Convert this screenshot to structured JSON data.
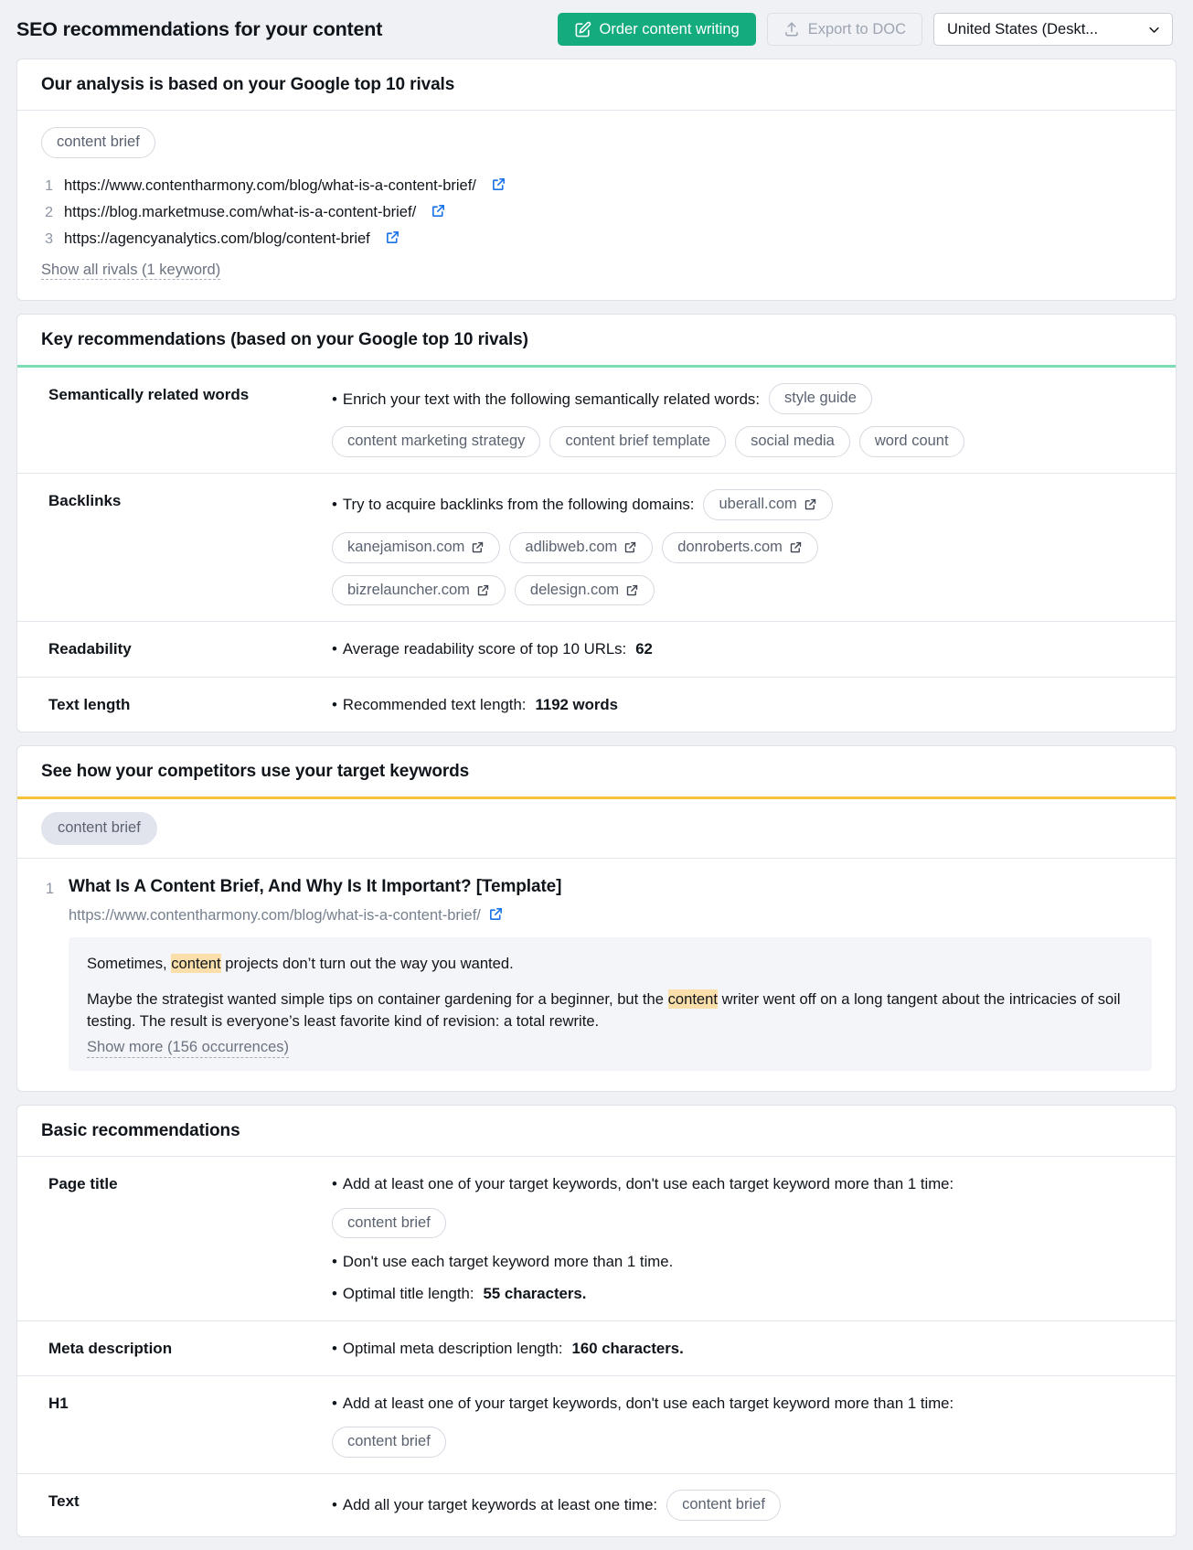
{
  "header": {
    "title": "SEO recommendations for your content",
    "order_button": "Order content writing",
    "export_button": "Export to DOC",
    "locale_select": "United States (Deskt...",
    "accent_green": "#14ab7f",
    "icons": {
      "order": "edit-square-icon",
      "export": "upload-icon",
      "chevron": "chevron-down-icon"
    }
  },
  "rivals_card": {
    "title": "Our analysis is based on your Google top 10 rivals",
    "keyword_chip": "content brief",
    "rivals": [
      {
        "index": "1",
        "url": "https://www.contentharmony.com/blog/what-is-a-content-brief/"
      },
      {
        "index": "2",
        "url": "https://blog.marketmuse.com/what-is-a-content-brief/"
      },
      {
        "index": "3",
        "url": "https://agencyanalytics.com/blog/content-brief"
      }
    ],
    "show_all_link": "Show all rivals (1 keyword)"
  },
  "key_recommendations": {
    "title": "Key recommendations (based on your Google top 10 rivals)",
    "accent_color": "#7ddcb4",
    "rows": [
      {
        "label": "Semantically related words",
        "bullet": "Enrich your text with the following semantically related words:",
        "chips": [
          "style guide",
          "content marketing strategy",
          "content brief template",
          "social media",
          "word count"
        ]
      },
      {
        "label": "Backlinks",
        "bullet": "Try to acquire backlinks from the following domains:",
        "chips": [
          "uberall.com",
          "kanejamison.com",
          "adlibweb.com",
          "donroberts.com",
          "bizrelauncher.com",
          "delesign.com"
        ]
      },
      {
        "label": "Readability",
        "bullet": "Average readability score of top 10 URLs:",
        "value": "62"
      },
      {
        "label": "Text length",
        "bullet": "Recommended text length:",
        "value": "1192 words"
      }
    ]
  },
  "competitors_card": {
    "title": "See how your competitors use your target keywords",
    "accent_color": "#f5c33b",
    "keyword_chip": "content brief",
    "result": {
      "index": "1",
      "title": "What Is A Content Brief, And Why Is It Important? [Template]",
      "url": "https://www.contentharmony.com/blog/what-is-a-content-brief/",
      "snippet_p1_before": "Sometimes, ",
      "snippet_p1_highlight": "content",
      "snippet_p1_after": " projects don’t turn out the way you wanted.",
      "snippet_p2_before": "Maybe the strategist wanted simple tips on container gardening for a beginner, but the ",
      "snippet_p2_highlight": "content",
      "snippet_p2_after": " writer went off on a long tangent about the intricacies of soil testing. The result is everyone’s least favorite kind of revision: a total rewrite.",
      "show_more_link": "Show more (156 occurrences)",
      "highlight_color": "#fadfab"
    }
  },
  "basic_recommendations": {
    "title": "Basic recommendations",
    "rows": [
      {
        "label": "Page title",
        "bullet1": "Add at least one of your target keywords, don't use each target keyword more than 1 time:",
        "chips": [
          "content brief"
        ],
        "bullet2": "Don't use each target keyword more than 1 time.",
        "bullet3_text": "Optimal title length:",
        "bullet3_value": "55 characters."
      },
      {
        "label": "Meta description",
        "bullet1_text": "Optimal meta description length:",
        "bullet1_value": "160 characters."
      },
      {
        "label": "H1",
        "bullet1": "Add at least one of your target keywords, don't use each target keyword more than 1 time:",
        "chips": [
          "content brief"
        ]
      },
      {
        "label": "Text",
        "bullet1": "Add all your target keywords at least one time:",
        "chips": [
          "content brief"
        ]
      }
    ]
  }
}
